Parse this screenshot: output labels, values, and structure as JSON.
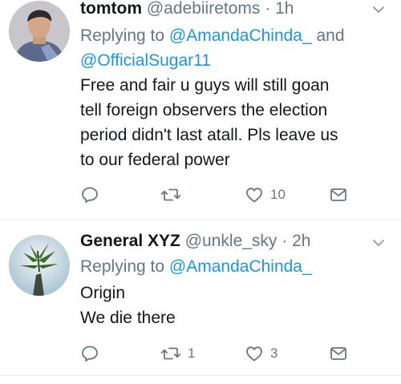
{
  "tweets": [
    {
      "name": "tomtom",
      "handle": "@adebiiretoms",
      "separator": "·",
      "time": "1h",
      "replying_prefix": "Replying to ",
      "mention_1": "@AmandaChinda_",
      "connector": " and",
      "mention_2": "@OfficialSugar11",
      "lines": [
        "Free and fair u guys will still goan",
        "tell foreign observers the election",
        "period didn't last atall. Pls leave us",
        "to our federal power"
      ],
      "retweet_count": "",
      "like_count": "10"
    },
    {
      "name": "General XYZ",
      "handle": "@unkle_sky",
      "separator": "·",
      "time": "2h",
      "replying_prefix": "Replying to ",
      "mention_1": "@AmandaChinda_",
      "lines": [
        "Origin",
        "We die there"
      ],
      "retweet_count": "1",
      "like_count": "3"
    }
  ],
  "colors": {
    "link": "#1b95e0",
    "secondary": "#657786",
    "text": "#14171a",
    "divider": "#e6ecf0"
  },
  "icons": [
    "reply-icon",
    "retweet-icon",
    "heart-icon",
    "message-icon",
    "chevron-down-icon"
  ]
}
